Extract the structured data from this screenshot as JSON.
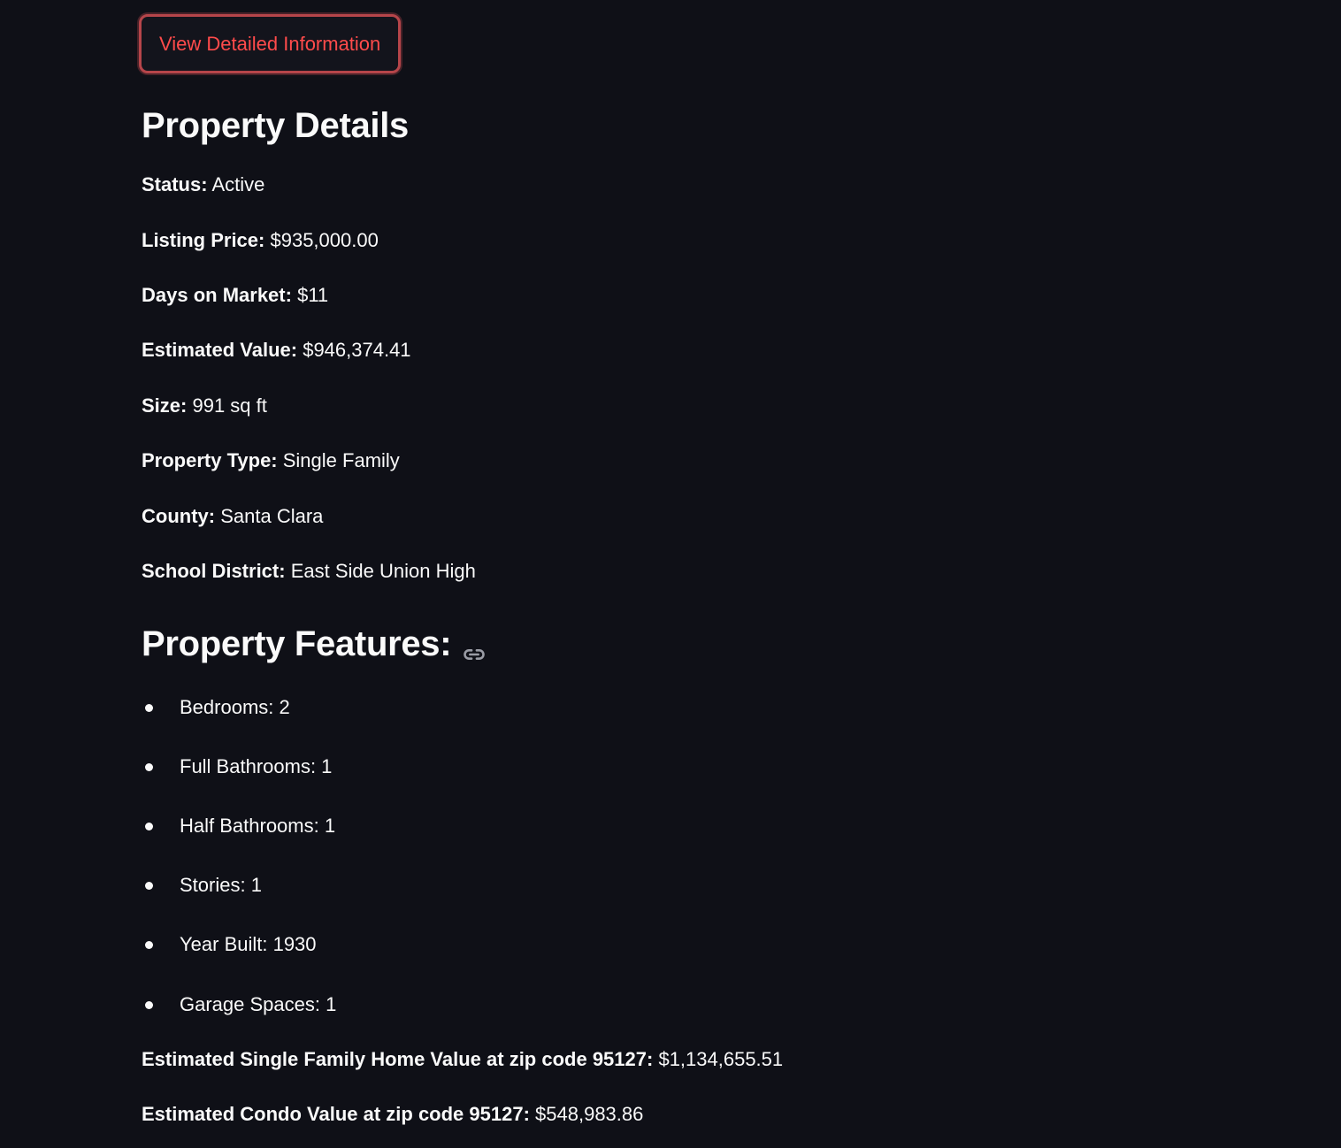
{
  "button": {
    "label": "View Detailed Information"
  },
  "details": {
    "heading": "Property Details",
    "rows": [
      {
        "key": "Status:",
        "value": "Active"
      },
      {
        "key": "Listing Price:",
        "value": "$935,000.00"
      },
      {
        "key": "Days on Market:",
        "value": "$11"
      },
      {
        "key": "Estimated Value:",
        "value": "$946,374.41"
      },
      {
        "key": "Size:",
        "value": "991 sq ft"
      },
      {
        "key": "Property Type:",
        "value": "Single Family"
      },
      {
        "key": "County:",
        "value": "Santa Clara"
      },
      {
        "key": "School District:",
        "value": "East Side Union High"
      }
    ]
  },
  "features": {
    "heading": "Property Features:",
    "icon": "link-icon",
    "items": [
      "Bedrooms: 2",
      "Full Bathrooms: 1",
      "Half Bathrooms: 1",
      "Stories: 1",
      "Year Built: 1930",
      "Garage Spaces: 1"
    ]
  },
  "estimates": [
    {
      "key": "Estimated Single Family Home Value at zip code 95127:",
      "value": "$1,134,655.51"
    },
    {
      "key": "Estimated Condo Value at zip code 95127:",
      "value": "$548,983.86"
    }
  ]
}
